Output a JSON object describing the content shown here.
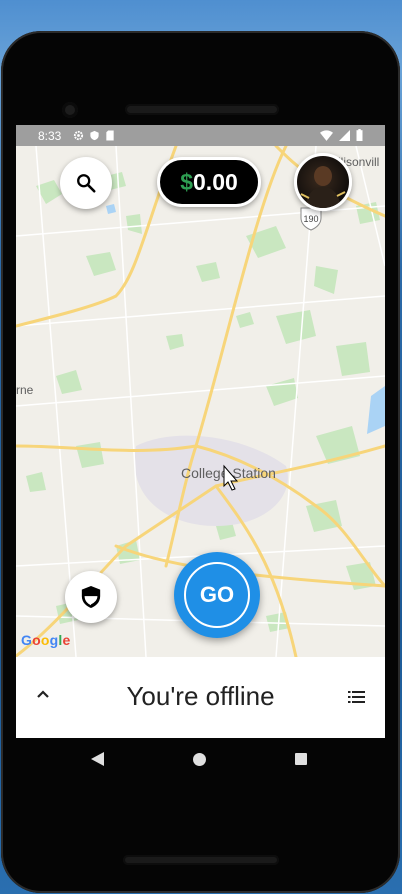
{
  "status_bar": {
    "time": "8:33"
  },
  "map": {
    "city_label": "College Station",
    "left_edge_label": "rne",
    "top_right_label": "dlisonvill",
    "highway_shield": "190",
    "attribution": "Google"
  },
  "header": {
    "balance_currency": "$",
    "balance_amount": "0.00"
  },
  "go_button": {
    "label": "GO"
  },
  "bottom_bar": {
    "status": "You're offline"
  },
  "colors": {
    "go_blue": "#1f8fe6",
    "currency_green": "#2e9e52",
    "status_bar_gray": "#9e9e9e"
  },
  "icons": [
    "search-icon",
    "shield-icon",
    "chevron-up-icon",
    "list-icon",
    "back-icon",
    "home-icon",
    "recent-apps-icon",
    "settings-icon",
    "wifi-icon",
    "signal-icon",
    "battery-icon"
  ]
}
